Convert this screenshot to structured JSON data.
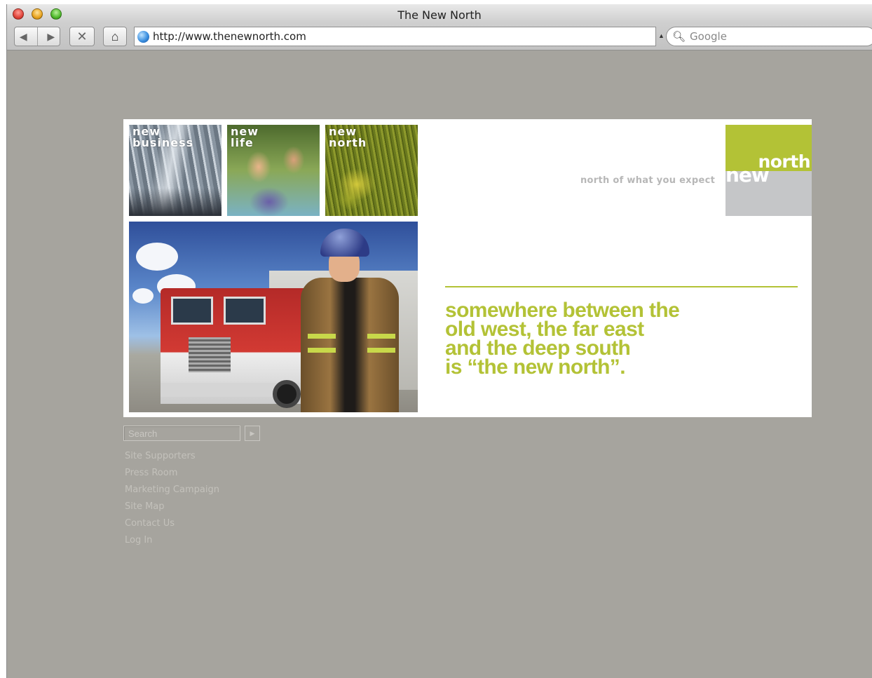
{
  "window": {
    "title": "The New North"
  },
  "toolbar": {
    "back_icon": "left-arrow-icon",
    "forward_icon": "right-arrow-icon",
    "stop_icon": "close-icon",
    "home_icon": "home-icon",
    "address": "http://www.thenewnorth.com",
    "search_placeholder": "Google"
  },
  "banner": {
    "tiles": [
      {
        "line1": "new",
        "line2": "business"
      },
      {
        "line1": "new",
        "line2": "life"
      },
      {
        "line1": "new",
        "line2": "north"
      }
    ],
    "tagline": "north of what you expect",
    "logo": {
      "word1": "north",
      "word2": "new",
      "accent": "#b3c236",
      "gray": "#c5c6c8"
    },
    "headline": [
      "somewhere between the",
      "old west, the far east",
      "and the deep south",
      "is “the new north”."
    ]
  },
  "site": {
    "search_placeholder": "Search",
    "links": [
      "Site Supporters",
      "Press Room",
      "Marketing Campaign",
      "Site Map",
      "Contact Us",
      "Log In"
    ]
  },
  "colors": {
    "page_bg": "#a6a49e",
    "brand_green": "#b3c236",
    "link_gray": "#c3c1bb"
  }
}
